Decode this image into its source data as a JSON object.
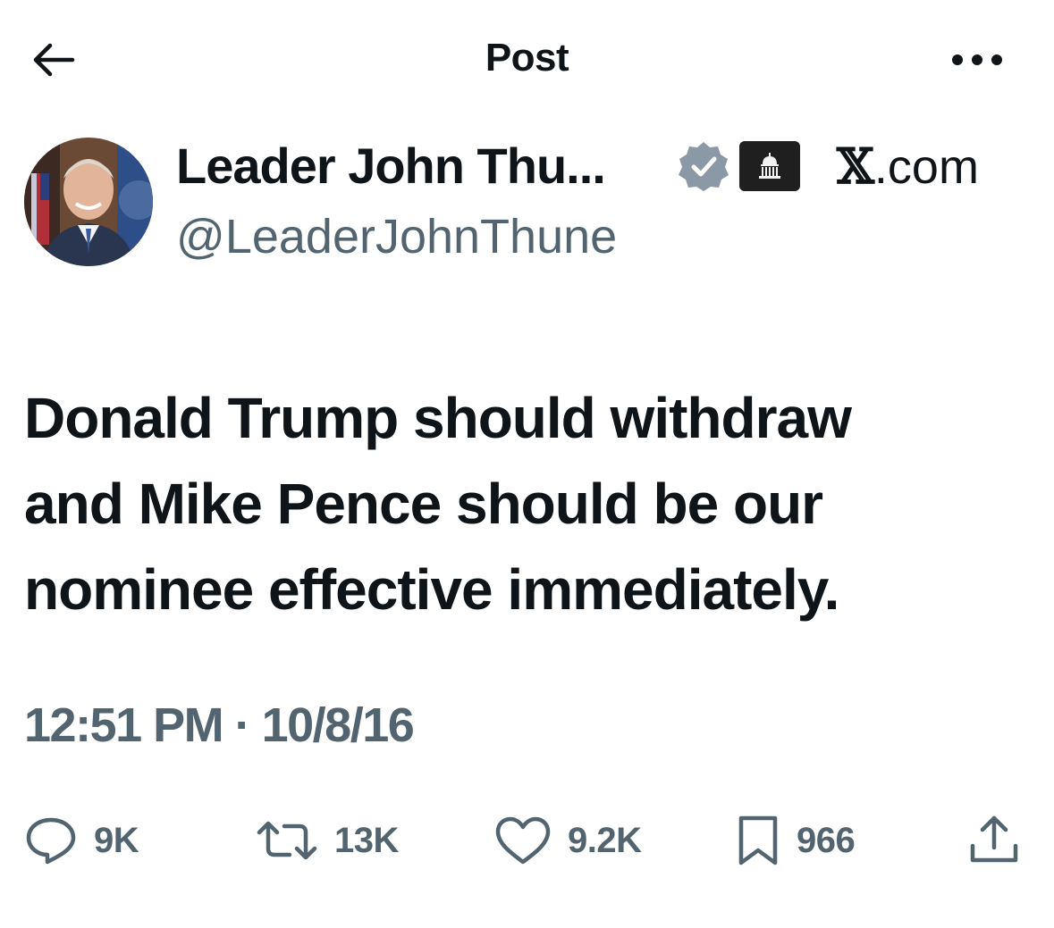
{
  "header": {
    "title": "Post",
    "back_icon": "arrow-left-icon",
    "more_icon": "more-dots-icon"
  },
  "author": {
    "display_name": "Leader John Thu...",
    "handle": "@LeaderJohnThune",
    "verified_icon": "verified-badge-icon",
    "verified_color": "#8b98a5",
    "affiliation_icon": "capitol-building-icon",
    "source_label_mark": "𝕏",
    "source_label_rest": ".com"
  },
  "tweet": {
    "lines": [
      "Donald Trump should withdraw",
      "and Mike Pence should be our",
      "nominee effective immediately."
    ],
    "timestamp": "12:51 PM · 10/8/16"
  },
  "actions": {
    "replies": "9K",
    "reposts": "13K",
    "likes": "9.2K",
    "bookmarks": "966"
  },
  "colors": {
    "text": "#0f1419",
    "secondary": "#536471"
  }
}
